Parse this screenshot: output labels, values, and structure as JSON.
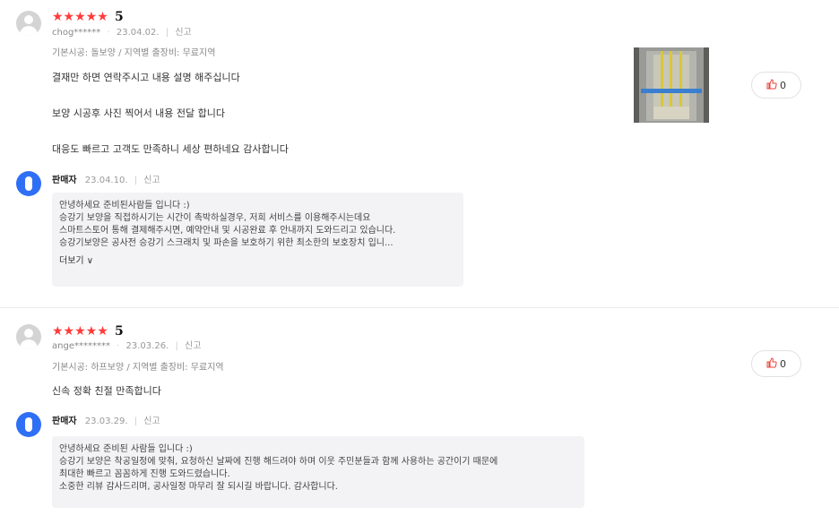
{
  "reviews": [
    {
      "stars": "★★★★★",
      "score": "5",
      "user": "chog******",
      "date": "23.04.02.",
      "report": "신고",
      "option": "기본시공: 돌보양 / 지역별 출장비: 무료지역",
      "body": [
        "결재만 하면 연락주시고 내용 설명 해주십니다",
        "보양 시공후 사진 찍어서 내용 전달 합니다",
        "대응도 빠르고 고객도 만족하니 세상 편하네요 감사합니다"
      ],
      "likes": "0",
      "seller": {
        "name": "판매자",
        "date": "23.04.10.",
        "report": "신고",
        "lines": [
          "안녕하세요 준비된사람들 입니다 :)",
          "승강기 보양을 직접하시기는 시간이 촉박하실경우, 저희 서비스를 이용해주시는데요",
          "스마트스토어 통해 결제해주시면, 예약안내 및 시공완료 후 안내까지 도와드리고 있습니다.",
          "승강기보양은 공사전 승강기 스크래치 및 파손을 보호하기 위한 최소한의 보호장치 입니..."
        ],
        "more": "더보기 ∨"
      }
    },
    {
      "stars": "★★★★★",
      "score": "5",
      "user": "ange********",
      "date": "23.03.26.",
      "report": "신고",
      "option": "기본시공: 하프보양 / 지역별 출장비: 무료지역",
      "body": [
        "신속 정확 친절 만족합니다"
      ],
      "likes": "0",
      "seller": {
        "name": "판매자",
        "date": "23.03.29.",
        "report": "신고",
        "lines": [
          "안녕하세요 준비된 사람들 입니다 :)",
          "승강기 보양은 착공일정에 맞춰, 요청하신 날짜에 진행 해드려야 하며 이웃 주민분들과 함께 사용하는 공간이기 때문에",
          "최대한 빠르고 꼼꼼하게 진행 도와드렸습니다.",
          "소중한 리뷰 감사드리며, 공사일정 마무리 잘 되시길 바랍니다. 감사합니다."
        ]
      }
    }
  ],
  "colors": {
    "star": "#ff3b3b",
    "like_icon": "#e8433a",
    "seller_badge": "#2f6ff5",
    "reply_bg": "#f3f3f5"
  },
  "icons": {
    "user_avatar": "user-avatar-icon",
    "seller_avatar": "seller-avatar-icon",
    "like": "thumbs-up-icon"
  }
}
